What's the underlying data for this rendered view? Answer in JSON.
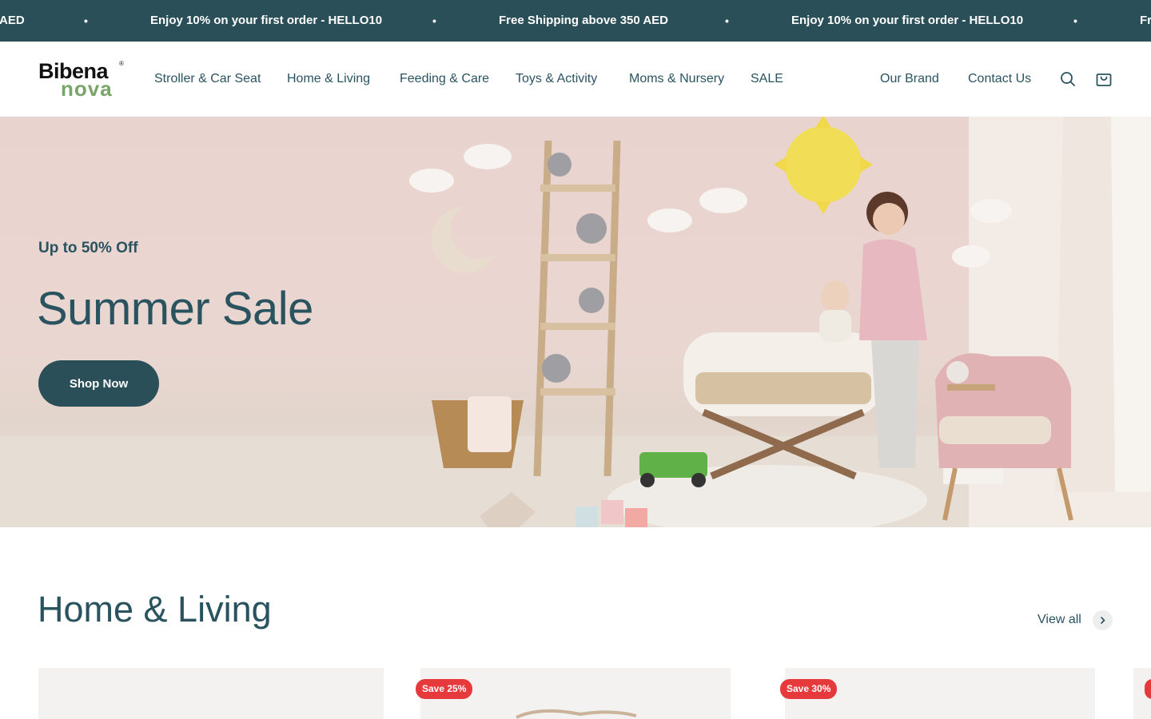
{
  "announcement": {
    "left_fragment": "AED",
    "msg1": "Enjoy 10% on your first order - HELLO10",
    "msg2": "Free Shipping above 350 AED",
    "msg3": "Enjoy 10% on your first order - HELLO10",
    "right_fragment": "Fr",
    "separator": "•"
  },
  "logo": {
    "line1": "Bibena",
    "line2": "nova",
    "mark": "®"
  },
  "nav": {
    "items": [
      "Stroller & Car Seat",
      "Home & Living",
      "Feeding & Care",
      "Toys & Activity",
      "Moms & Nursery",
      "SALE"
    ],
    "secondary": [
      "Our Brand",
      "Contact Us"
    ]
  },
  "icons": {
    "search": "search-icon",
    "cart": "cart-icon",
    "chevron": "chevron-right-icon"
  },
  "hero": {
    "subtitle": "Up to 50% Off",
    "title": "Summer Sale",
    "button": "Shop Now"
  },
  "section": {
    "title": "Home & Living",
    "view_all": "View all"
  },
  "products": [
    {
      "badge": ""
    },
    {
      "badge": "Save 25%"
    },
    {
      "badge": "Save 30%"
    },
    {
      "badge": ""
    }
  ],
  "colors": {
    "primary": "#2a4f58",
    "text": "#2a5360",
    "sale_badge": "#e6393c",
    "logo_green": "#7aa56a"
  }
}
